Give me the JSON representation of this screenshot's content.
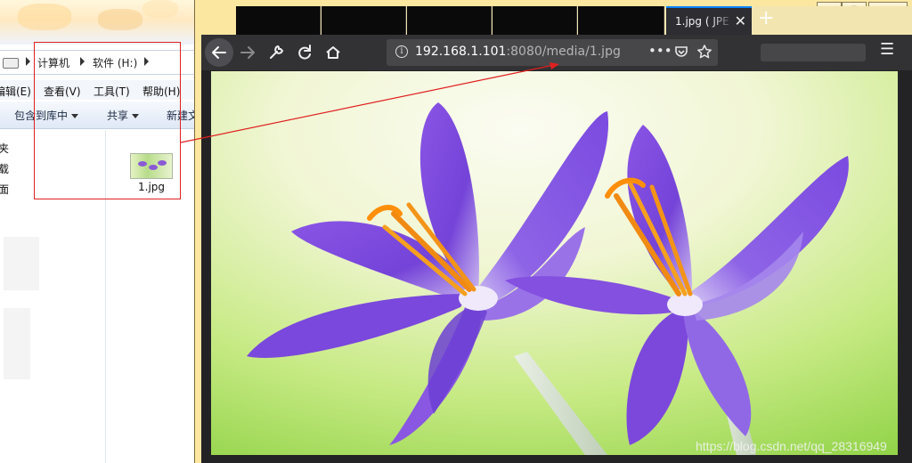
{
  "explorer": {
    "breadcrumb": [
      "计算机",
      "软件 (H:)"
    ],
    "menu": [
      "编辑(E)",
      "查看(V)",
      "工具(T)",
      "帮助(H)"
    ],
    "toolbar": [
      "包含到库中",
      "共享",
      "新建文"
    ],
    "nav_items": [
      "夹",
      "载",
      "面"
    ],
    "file": {
      "name": "1.jpg",
      "icon": "image-thumbnail-icon"
    }
  },
  "browser": {
    "active_tab": "1.jpg ( JPE",
    "url_host": "192.168.1.101",
    "url_rest": ":8080/media/1.jpg",
    "icons": {
      "back": "back-arrow-icon",
      "forward": "forward-arrow-icon",
      "tools": "wrench-icon",
      "reload": "reload-icon",
      "home": "home-icon",
      "info": "info-icon",
      "more": "more-dots-icon",
      "pocket": "pocket-icon",
      "bookmark": "star-icon",
      "menu": "hamburger-menu-icon"
    },
    "image_alt": "purple crocus flowers",
    "watermark": "https://blog.csdn.net/qq_28316949"
  },
  "colors": {
    "annotation_red": "#e02020",
    "tab_accent": "#0a84ff",
    "toolbar": "#323234"
  }
}
